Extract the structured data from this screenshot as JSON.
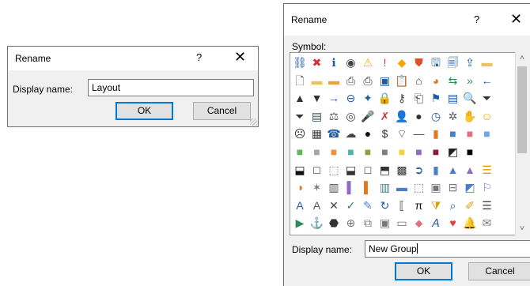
{
  "small_dialog": {
    "title": "Rename",
    "help": "?",
    "close": "✕",
    "label": "Display name:",
    "value": "Layout",
    "ok": "OK",
    "cancel": "Cancel"
  },
  "large_dialog": {
    "title": "Rename",
    "help": "?",
    "close": "✕",
    "symbol_label": "Symbol:",
    "label": "Display name:",
    "value": "New Group",
    "ok": "OK",
    "cancel": "Cancel",
    "scroll_up": "˄",
    "scroll_down": "˅",
    "symbols": [
      [
        [
          "sitemap-icon",
          "⛓",
          "#1f5aa6"
        ],
        [
          "error-icon",
          "✖",
          "#d13438"
        ],
        [
          "info-icon",
          "ℹ",
          "#1f5aa6"
        ],
        [
          "record-icon",
          "◉",
          "#444444"
        ],
        [
          "warning-icon",
          "⚠",
          "#f2b400"
        ],
        [
          "exclamation-icon",
          "!",
          "#d13438"
        ],
        [
          "diamond-warning-icon",
          "◆",
          "#f7a400"
        ],
        [
          "shield-icon",
          "⛊",
          "#e0502a"
        ],
        [
          "save-icon",
          "🖫",
          "#1f5aa6"
        ],
        [
          "save-all-icon",
          "🗐",
          "#1f5aa6"
        ],
        [
          "share-icon",
          "⇪",
          "#1f5aa6"
        ],
        [
          "folder-icon",
          "▬",
          "#e8c45a"
        ],
        [
          "blank-icon",
          "",
          ""
        ]
      ],
      [
        [
          "document-icon",
          "🗋",
          "#444444"
        ],
        [
          "folder-open-icon",
          "▬",
          "#e8c45a"
        ],
        [
          "folders-icon",
          "▬",
          "#e8a33c"
        ],
        [
          "printer-outline-icon",
          "⎙",
          "#444444"
        ],
        [
          "printer-icon",
          "⎙",
          "#333333"
        ],
        [
          "picture-icon",
          "▣",
          "#1f5aa6"
        ],
        [
          "clipboard-icon",
          "📋",
          "#888888"
        ],
        [
          "home-icon",
          "⌂",
          "#444444"
        ],
        [
          "pie-icon",
          "◕",
          "#e07a1f"
        ],
        [
          "back-forward-icon",
          "⇆",
          "#2e8b57"
        ],
        [
          "forward-icon",
          "»",
          "#2e8b57"
        ],
        [
          "left-arrow-icon",
          "←",
          "#1f5aa6"
        ],
        [
          "blank-icon",
          "",
          ""
        ]
      ],
      [
        [
          "triangle-up-icon",
          "▲",
          "#333333"
        ],
        [
          "triangle-down-icon",
          "▼",
          "#333333"
        ],
        [
          "arrow-right-icon",
          "→",
          "#1f5aa6"
        ],
        [
          "arrow-left-circle-icon",
          "⊖",
          "#1f5aa6"
        ],
        [
          "pin-icon",
          "✦",
          "#1f5aa6"
        ],
        [
          "lock-icon",
          "🔒",
          "#e0a000"
        ],
        [
          "key-icon",
          "⚷",
          "#444444"
        ],
        [
          "page-icon",
          "⎗",
          "#444444"
        ],
        [
          "flag-icon",
          "⚑",
          "#1f5aa6"
        ],
        [
          "window-icon",
          "▤",
          "#1f5aa6"
        ],
        [
          "magnifier-icon",
          "🔍",
          "#444444"
        ],
        [
          "filter-icon",
          "⏷",
          "#333333"
        ],
        [
          "blank-icon",
          "",
          ""
        ]
      ],
      [
        [
          "funnel-icon",
          "⏷",
          "#333333"
        ],
        [
          "address-book-icon",
          "▤",
          "#1f5aa6"
        ],
        [
          "scales-icon",
          "⚖",
          "#555555"
        ],
        [
          "toggle-icon",
          "◎",
          "#444444"
        ],
        [
          "microphone-icon",
          "🎤",
          "#1f5aa6"
        ],
        [
          "mute-icon",
          "✗",
          "#d13438"
        ],
        [
          "user-icon",
          "👤",
          "#333333"
        ],
        [
          "users-icon",
          "●",
          "#333333"
        ],
        [
          "clock-icon",
          "◷",
          "#1f5aa6"
        ],
        [
          "gear-icon",
          "✲",
          "#555555"
        ],
        [
          "hand-icon",
          "✋",
          "#444444"
        ],
        [
          "smiley-icon",
          "☺",
          "#e0b000"
        ],
        [
          "blank-icon",
          "",
          ""
        ]
      ],
      [
        [
          "frown-icon",
          "☹",
          "#333333"
        ],
        [
          "calculator-icon",
          "▦",
          "#444444"
        ],
        [
          "phone-icon",
          "☎",
          "#1f5aa6"
        ],
        [
          "cloud-icon",
          "☁",
          "#444444"
        ],
        [
          "eight-ball-icon",
          "●",
          "#111111"
        ],
        [
          "dollar-icon",
          "$",
          "#333333"
        ],
        [
          "wifi-icon",
          "⌔",
          "#444444"
        ],
        [
          "line-icon",
          "—",
          "#444444"
        ],
        [
          "bar-icon",
          "▮",
          "#e07a1f"
        ],
        [
          "square-blue-icon",
          "■",
          "#4a7ec9"
        ],
        [
          "square-pink-icon",
          "■",
          "#e0707a"
        ],
        [
          "square-lightblue-icon",
          "■",
          "#6fa8dc"
        ],
        [
          "blank-icon",
          "",
          ""
        ]
      ],
      [
        [
          "square-green-icon",
          "■",
          "#5cb85c"
        ],
        [
          "square-gray-icon",
          "■",
          "#a6a6a6"
        ],
        [
          "square-orange-icon",
          "■",
          "#f0923a"
        ],
        [
          "square-teal-icon",
          "■",
          "#4db6ac"
        ],
        [
          "square-olive-icon",
          "■",
          "#9c9c3a"
        ],
        [
          "square-darkgray-icon",
          "■",
          "#7f7f7f"
        ],
        [
          "square-yellow-icon",
          "■",
          "#f2d23a"
        ],
        [
          "square-purple-icon",
          "■",
          "#8e6cc0"
        ],
        [
          "square-maroon-icon",
          "■",
          "#8b1c3a"
        ],
        [
          "square-split-icon",
          "◩",
          "#222222"
        ],
        [
          "square-black-icon",
          "■",
          "#000000"
        ],
        [
          "blank-icon",
          "",
          ""
        ],
        [
          "blank-icon",
          "",
          ""
        ]
      ],
      [
        [
          "half-square-icon",
          "⬓",
          "#111111"
        ],
        [
          "square-outline-icon",
          "□",
          "#111111"
        ],
        [
          "dotted-square-icon",
          "⬚",
          "#777777"
        ],
        [
          "bottom-bar-icon",
          "⬓",
          "#333333"
        ],
        [
          "outline-square-2-icon",
          "□",
          "#111111"
        ],
        [
          "filled-square-2-icon",
          "⬒",
          "#333333"
        ],
        [
          "qr-icon",
          "▩",
          "#333333"
        ],
        [
          "circle-arrow-icon",
          "➲",
          "#1f5aa6"
        ],
        [
          "bar-chart-icon",
          "▮",
          "#4a7ec9"
        ],
        [
          "cone-icon",
          "▲",
          "#4a7ec9"
        ],
        [
          "mountain-chart-icon",
          "▲",
          "#8e6cc0"
        ],
        [
          "stack-chart-icon",
          "☰",
          "#e0a000"
        ],
        [
          "blank-icon",
          "",
          ""
        ]
      ],
      [
        [
          "pie-chart-icon",
          "◑",
          "#e07a1f"
        ],
        [
          "radar-icon",
          "✶",
          "#777777"
        ],
        [
          "cylinder-icon",
          "▥",
          "#555555"
        ],
        [
          "book-icon",
          "▌",
          "#8e6cc0"
        ],
        [
          "orange-book-icon",
          "▌",
          "#e07a1f"
        ],
        [
          "chart-doc-icon",
          "▥",
          "#4a7ec9"
        ],
        [
          "area-chart-icon",
          "▬",
          "#4a7ec9"
        ],
        [
          "dashed-frame-icon",
          "⬚",
          "#777777"
        ],
        [
          "frame-icon",
          "▣",
          "#777777"
        ],
        [
          "boxes-icon",
          "⊟",
          "#777777"
        ],
        [
          "image-chart-icon",
          "◩",
          "#4a7ec9"
        ],
        [
          "flag-chart-icon",
          "⚐",
          "#8e6cc0"
        ],
        [
          "blank-icon",
          "",
          ""
        ]
      ],
      [
        [
          "letter-a-box-icon",
          "A",
          "#1f5aa6"
        ],
        [
          "letter-a-gray-icon",
          "A",
          "#555555"
        ],
        [
          "cross-icon",
          "✕",
          "#444444"
        ],
        [
          "check-icon",
          "✓",
          "#2e8b57"
        ],
        [
          "edit-chart-icon",
          "✎",
          "#4a7ec9"
        ],
        [
          "refresh-icon",
          "↻",
          "#1f5aa6"
        ],
        [
          "brackets-icon",
          "⟦",
          "#444444"
        ],
        [
          "pi-icon",
          "π",
          "#111111"
        ],
        [
          "bucket-icon",
          "⧩",
          "#e0a000"
        ],
        [
          "magnify-icon",
          "⌕",
          "#1f5aa6"
        ],
        [
          "brush-icon",
          "✐",
          "#e0a000"
        ],
        [
          "list-icon",
          "☰",
          "#444444"
        ],
        [
          "blank-icon",
          "",
          ""
        ]
      ],
      [
        [
          "play-icon",
          "▶",
          "#2e8b57"
        ],
        [
          "anchor-icon",
          "⚓",
          "#1f5aa6"
        ],
        [
          "bag-icon",
          "⬣",
          "#333333"
        ],
        [
          "add-node-icon",
          "⊕",
          "#777777"
        ],
        [
          "layout-icon",
          "⧉",
          "#777777"
        ],
        [
          "gallery-icon",
          "▣",
          "#777777"
        ],
        [
          "frame-empty-icon",
          "▭",
          "#777777"
        ],
        [
          "eraser-icon",
          "⬥",
          "#e0707a"
        ],
        [
          "a-arrow-icon",
          "𝘈",
          "#1f5aa6"
        ],
        [
          "heart-icon",
          "♥",
          "#e04040"
        ],
        [
          "bell-icon",
          "🔔",
          "#e0a000"
        ],
        [
          "envelope-icon",
          "✉",
          "#777777"
        ],
        [
          "blank-icon",
          "",
          ""
        ]
      ]
    ]
  }
}
